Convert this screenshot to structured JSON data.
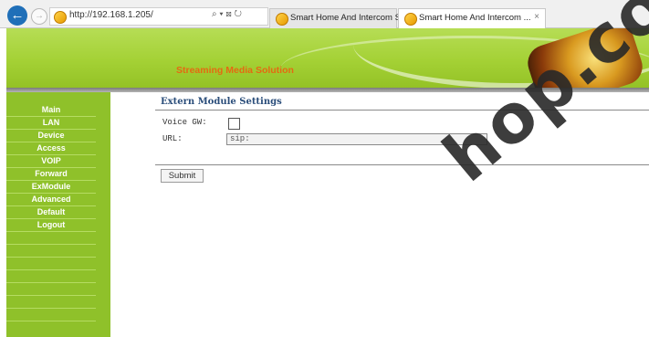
{
  "browser": {
    "address_url": "http://192.168.1.205/",
    "address_tools": "⌕ ▾ ⊠ ↻",
    "tabs": [
      {
        "title": "Smart Home And Intercom Sys..."
      },
      {
        "title": "Smart Home And Intercom ...",
        "close": "×"
      }
    ]
  },
  "banner": {
    "title": "Streaming Media Solution"
  },
  "sidebar": {
    "items": [
      {
        "label": "Main"
      },
      {
        "label": "LAN"
      },
      {
        "label": "Device"
      },
      {
        "label": "Access"
      },
      {
        "label": "VOIP"
      },
      {
        "label": "Forward"
      },
      {
        "label": "ExModule"
      },
      {
        "label": "Advanced"
      },
      {
        "label": "Default"
      },
      {
        "label": "Logout"
      }
    ]
  },
  "main": {
    "heading": "Extern Module Settings",
    "voice_gw_label": "Voice GW:",
    "voice_gw_checked": false,
    "url_label": "URL:",
    "url_value": "sip:",
    "submit_label": "Submit"
  },
  "watermark": "hop.co",
  "colors": {
    "sidebar": "#8fc12a",
    "banner": "#a4d135",
    "banner_title": "#e46a12",
    "heading": "#2a4d7a",
    "back_button": "#1f6fb8"
  }
}
